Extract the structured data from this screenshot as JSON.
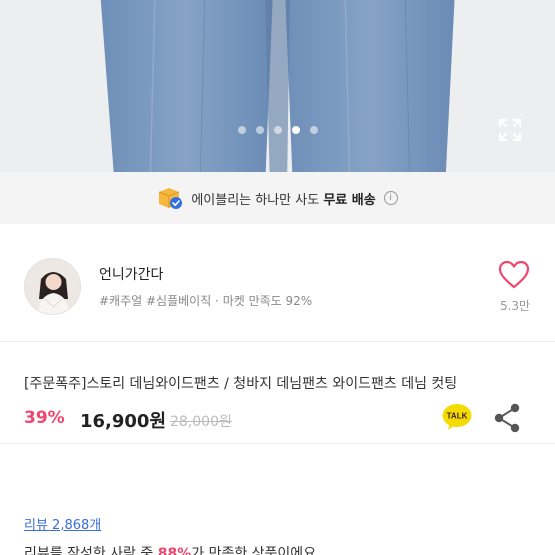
{
  "gallery": {
    "dot_count": 5,
    "active_index": 3
  },
  "shipping_banner": {
    "text_prefix": "에이블리는 하나만 사도 ",
    "text_bold": "무료 배송",
    "info_icon": "i"
  },
  "seller": {
    "name": "언니가간다",
    "tags": "#캐주얼 #심플베이직 · 마켓 만족도 92%",
    "like_count": "5.3만"
  },
  "product": {
    "title": "[주문폭주]스토리 데님와이드팬츠 / 청바지 데님팬츠 와이드팬츠 데님 컷팅",
    "discount": "39%",
    "price": "16,900원",
    "original_price": "28,000원",
    "talk_label": "TALK"
  },
  "review": {
    "count_link": "리뷰 2,868개",
    "summary_prefix": "리뷰를 작성한 사람 중 ",
    "summary_pct": "88%",
    "summary_suffix": "가 만족한 상품이에요"
  },
  "colors": {
    "accent_pink": "#f0466e",
    "link_blue": "#3a6fd8",
    "kakao_yellow": "#f5dc00"
  }
}
